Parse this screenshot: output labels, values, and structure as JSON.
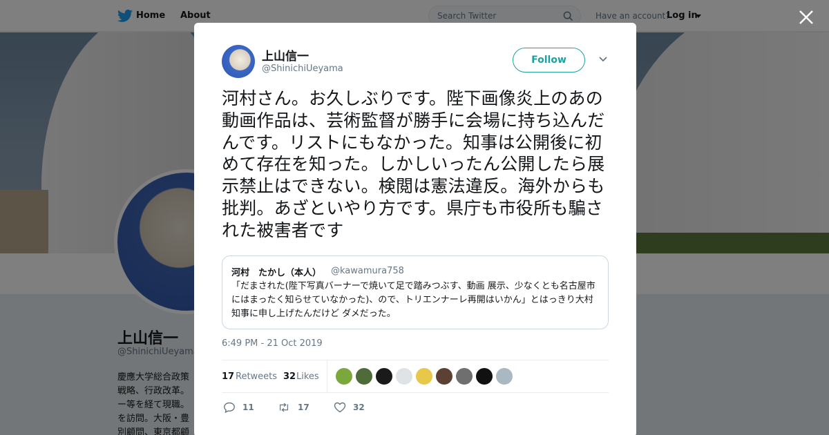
{
  "nav": {
    "home_label": "Home",
    "about_label": "About",
    "search_placeholder": "Search Twitter",
    "have_account": "Have an account?",
    "login_label": "Log in"
  },
  "profile": {
    "name": "上山信一",
    "handle": "@ShinichiUeyama",
    "bio_lines": [
      "慶應大学総合政策",
      "戦略、行政改革。",
      "ー等を経て現職。",
      "を訪問。大阪・豊",
      "別顧問、東京都顧"
    ]
  },
  "tweet": {
    "author_name": "上山信一",
    "author_handle": "@ShinichiUeyama",
    "follow_label": "Follow",
    "text": "河村さん。お久しぶりです。陛下画像炎上のあの動画作品は、芸術監督が勝手に会場に持ち込んだんです。リストにもなかった。知事は公開後に初めて存在を知った。しかしいったん公開したら展示禁止はできない。検閲は憲法違反。海外からも批判。あざといやり方です。県庁も市役所も騙された被害者です",
    "quoted": {
      "name": "河村　たかし（本人）",
      "handle": "@kawamura758",
      "text": "「だまされた(陛下写真バーナーで焼いて足で踏みつぶす、動画 展示、少なくとも名古屋市にはまったく知らせていなかった)、ので、トリエンナーレ再開はいかん」とはっきり大村知事に申し上げたんだけど ダメだった。"
    },
    "timestamp": "6:49 PM - 21 Oct 2019",
    "retweets_count": "17",
    "retweets_label": "Retweets",
    "likes_count": "32",
    "likes_label": "Likes",
    "reply_count": "11",
    "retweet_action_count": "17",
    "like_action_count": "32"
  },
  "likers": [
    {
      "color": "#7aa83c"
    },
    {
      "color": "#4f6b3a"
    },
    {
      "color": "#1a1a1a"
    },
    {
      "color": "#dfe3e6"
    },
    {
      "color": "#e8c84a"
    },
    {
      "color": "#5c4033"
    },
    {
      "color": "#6f6f6f"
    },
    {
      "color": "#111111"
    },
    {
      "color": "#aab8c2"
    }
  ],
  "colors": {
    "accent": "#1da1f2",
    "follow": "#1da1a0"
  }
}
